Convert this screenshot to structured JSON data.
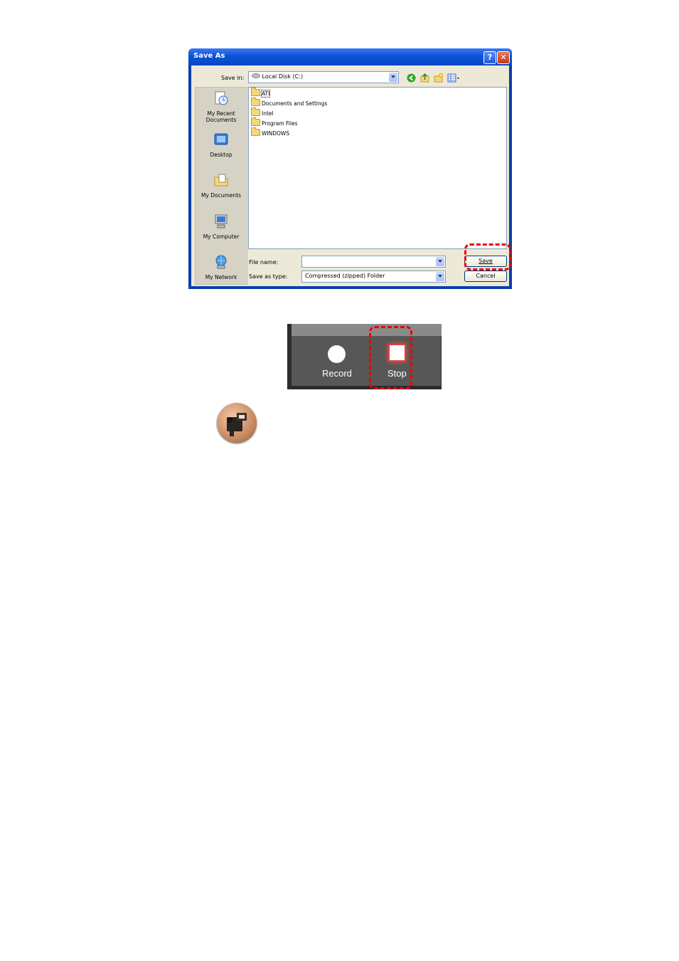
{
  "dialog": {
    "title": "Save As",
    "help_label": "?",
    "close_label": "✕",
    "save_in_label": "Save in:",
    "save_in_value": "Local Disk (C:)",
    "places": [
      {
        "label": "My Recent Documents",
        "icon": "recent-documents-icon"
      },
      {
        "label": "Desktop",
        "icon": "desktop-icon"
      },
      {
        "label": "My Documents",
        "icon": "my-documents-icon"
      },
      {
        "label": "My Computer",
        "icon": "my-computer-icon"
      },
      {
        "label": "My Network",
        "icon": "my-network-icon"
      }
    ],
    "files": [
      "ATI",
      "Documents and Settings",
      "Intel",
      "Program Files",
      "WINDOWS"
    ],
    "file_name_label": "File name:",
    "file_name_value": "",
    "save_as_type_label": "Save as type:",
    "save_as_type_value": "Compressed (zipped) Folder",
    "save_button": "Save",
    "cancel_button": "Cancel",
    "highlight_color": "#e00000"
  },
  "recorder": {
    "record_label": "Record",
    "stop_label": "Stop",
    "highlight_color": "#e00000"
  },
  "camcorder_icon": "camcorder-icon"
}
